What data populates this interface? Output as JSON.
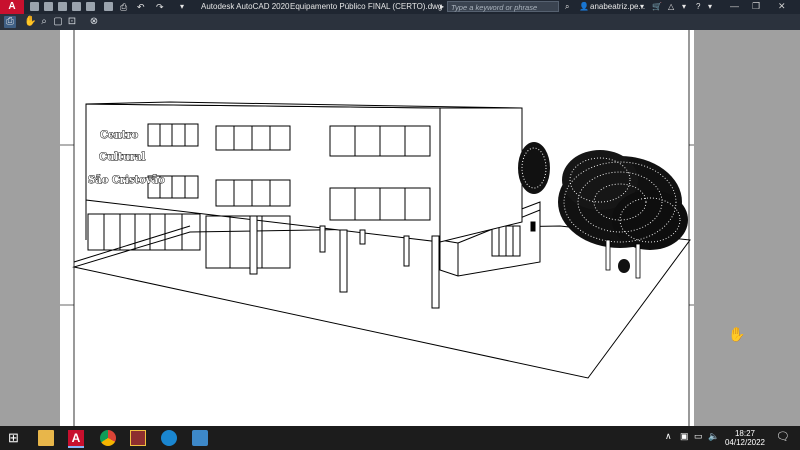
{
  "window": {
    "app_name": "Autodesk AutoCAD 2020",
    "file_name": "Equipamento Público FINAL (CERTO).dwg"
  },
  "search": {
    "placeholder": "Type a keyword or phrase"
  },
  "user": {
    "name": "anabeatriz.pe..."
  },
  "drawing": {
    "sign_lines": [
      "Centro",
      "Cultural",
      "São Cristovão"
    ]
  },
  "taskbar": {
    "time": "18:27",
    "date": "04/12/2022"
  },
  "colors": {
    "titlebar": "#1f2631",
    "toolbar": "#2b323d",
    "autocad_red": "#c8102e",
    "canvas": "#a0a0a0",
    "taskbar": "#1c1c1c"
  }
}
